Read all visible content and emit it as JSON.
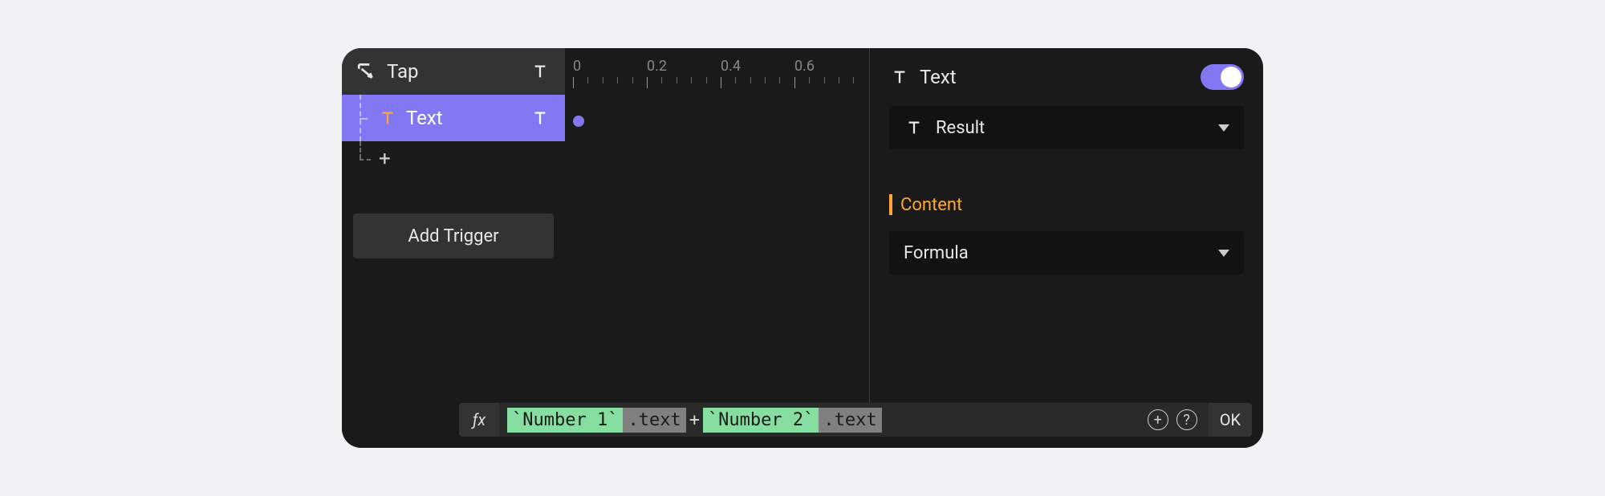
{
  "sidebar": {
    "trigger_name": "Tap",
    "layer_label": "Text",
    "add_trigger_label": "Add Trigger"
  },
  "timeline": {
    "ticks": [
      "0",
      "0.2",
      "0.4",
      "0.6"
    ]
  },
  "inspector": {
    "header_label": "Text",
    "toggle_on": true,
    "target_label": "Result",
    "section_label": "Content",
    "content_type_label": "Formula"
  },
  "formula": {
    "fx_label": "ƒx",
    "tokens": [
      {
        "kind": "var",
        "text": "`Number 1`"
      },
      {
        "kind": "prop",
        "text": ".text"
      },
      {
        "kind": "op",
        "text": "+"
      },
      {
        "kind": "var",
        "text": "`Number 2`"
      },
      {
        "kind": "prop",
        "text": ".text"
      }
    ],
    "ok_label": "OK",
    "add_icon": "+",
    "help_icon": "?"
  }
}
